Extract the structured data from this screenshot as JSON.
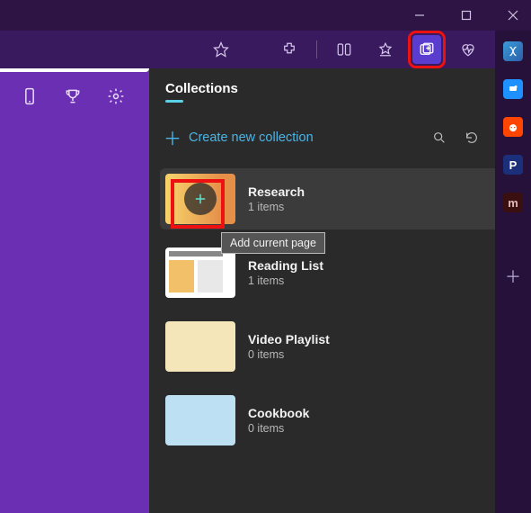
{
  "panel": {
    "title": "Collections",
    "create_label": "Create new collection"
  },
  "tooltip": "Add current page",
  "collections": [
    {
      "title": "Research",
      "sub": "1 items",
      "thumb": "research",
      "hover": true,
      "more": true
    },
    {
      "title": "Reading List",
      "sub": "1 items",
      "thumb": "reading",
      "hover": false,
      "more": false
    },
    {
      "title": "Video Playlist",
      "sub": "0 items",
      "thumb": "video",
      "hover": false,
      "more": false
    },
    {
      "title": "Cookbook",
      "sub": "0 items",
      "thumb": "cook",
      "hover": false,
      "more": false
    }
  ]
}
